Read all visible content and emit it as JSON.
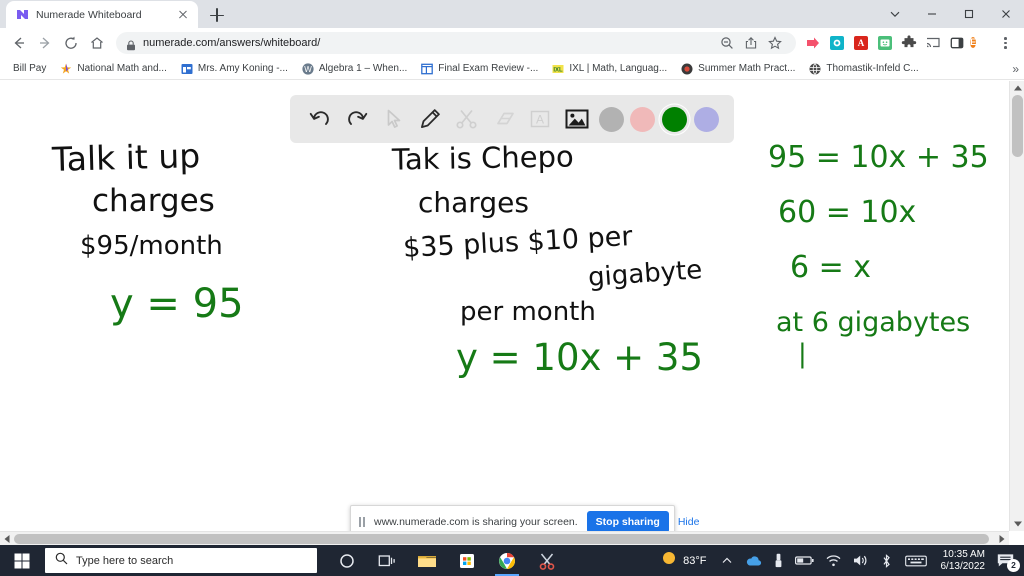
{
  "window": {
    "controls": {
      "collapse": "chevron-down",
      "minimize": "minimize",
      "maximize": "maximize",
      "close": "close"
    }
  },
  "tabstrip": {
    "tabs": [
      {
        "title": "Numerade Whiteboard",
        "favicon": "numerade-logo",
        "close_label": "×"
      }
    ],
    "new_tab_label": "+"
  },
  "navbar": {
    "back_label": "back-arrow",
    "forward_label": "forward-arrow",
    "reload_label": "reload",
    "home_label": "home",
    "url": "numerade.com/answers/whiteboard/",
    "lock_label": "site-information",
    "actions": [
      "zoom-out-icon",
      "share-icon",
      "bookmark-star-icon"
    ],
    "extensions": [
      "numerade-extension",
      "teal-circle-extension",
      "adobe-acrobat-extension",
      "screencastify-extension",
      "extensions-puzzle-icon",
      "cast-icon",
      "side-panel-icon"
    ],
    "profile_initial": "E",
    "menu_label": "chrome-menu"
  },
  "bookmarks": {
    "items": [
      {
        "label": "Bill Pay",
        "icon": "none"
      },
      {
        "label": "National Math and...",
        "icon": "star-colored"
      },
      {
        "label": "Mrs. Amy Koning -...",
        "icon": "blue-grid"
      },
      {
        "label": "Algebra 1 – When...",
        "icon": "wordpress"
      },
      {
        "label": "Final Exam Review -...",
        "icon": "blue-outline-grid"
      },
      {
        "label": "IXL | Math, Languag...",
        "icon": "ixl"
      },
      {
        "label": "Summer Math Pract...",
        "icon": "dark-circle"
      },
      {
        "label": "Thomastik-Infeld C...",
        "icon": "globe"
      }
    ],
    "overflow_label": "»"
  },
  "whiteboard": {
    "toolbar": {
      "tools": [
        {
          "name": "undo",
          "state": "enabled"
        },
        {
          "name": "redo",
          "state": "enabled"
        },
        {
          "name": "select-cursor",
          "state": "disabled"
        },
        {
          "name": "pencil",
          "state": "enabled"
        },
        {
          "name": "scissors",
          "state": "disabled"
        },
        {
          "name": "eraser",
          "state": "disabled"
        },
        {
          "name": "text-box",
          "state": "disabled"
        },
        {
          "name": "insert-image",
          "state": "enabled"
        }
      ],
      "colors": [
        {
          "name": "gray",
          "hex": "#b2b2b2",
          "selected": false
        },
        {
          "name": "pink",
          "hex": "#f0b9b9",
          "selected": false
        },
        {
          "name": "green",
          "hex": "#008000",
          "selected": true
        },
        {
          "name": "purple",
          "hex": "#aeaee4",
          "selected": false
        }
      ]
    },
    "ink": {
      "black_hex": "#111111",
      "green_hex": "#167a16",
      "column1": {
        "line1": "Talk it up",
        "line2": "charges",
        "line3": "$95/month",
        "answer": "y = 95"
      },
      "column2": {
        "line1": "Tak is Chepo",
        "line2": "charges",
        "line3": "$35 plus $10 per",
        "line4": "gigabyte",
        "line5": "per month",
        "answer": "y = 10x + 35"
      },
      "column3": {
        "line1": "95 = 10x + 35",
        "line2": "60 = 10x",
        "line3": "6 = x",
        "line4": "at 6 gigabytes",
        "line5": "|"
      }
    }
  },
  "sharebar": {
    "message": "www.numerade.com is sharing your screen.",
    "stop_label": "Stop sharing",
    "hide_label": "Hide"
  },
  "taskbar": {
    "start_label": "start-button",
    "search_placeholder": "Type here to search",
    "pinned": [
      "cortana-icon",
      "task-view-icon",
      "file-explorer-icon",
      "microsoft-store-icon",
      "google-chrome-icon",
      "snipping-tool-icon"
    ],
    "tray": {
      "weather_icon": "sun-icon",
      "temperature": "83°F",
      "overflow_label": "show-hidden-icons",
      "icons": [
        "onedrive-icon",
        "usb-icon",
        "battery-icon",
        "wifi-icon",
        "volume-icon",
        "bluetooth-icon",
        "keyboard-icon"
      ],
      "time": "10:35 AM",
      "date": "6/13/2022",
      "notification_count": "2"
    }
  }
}
